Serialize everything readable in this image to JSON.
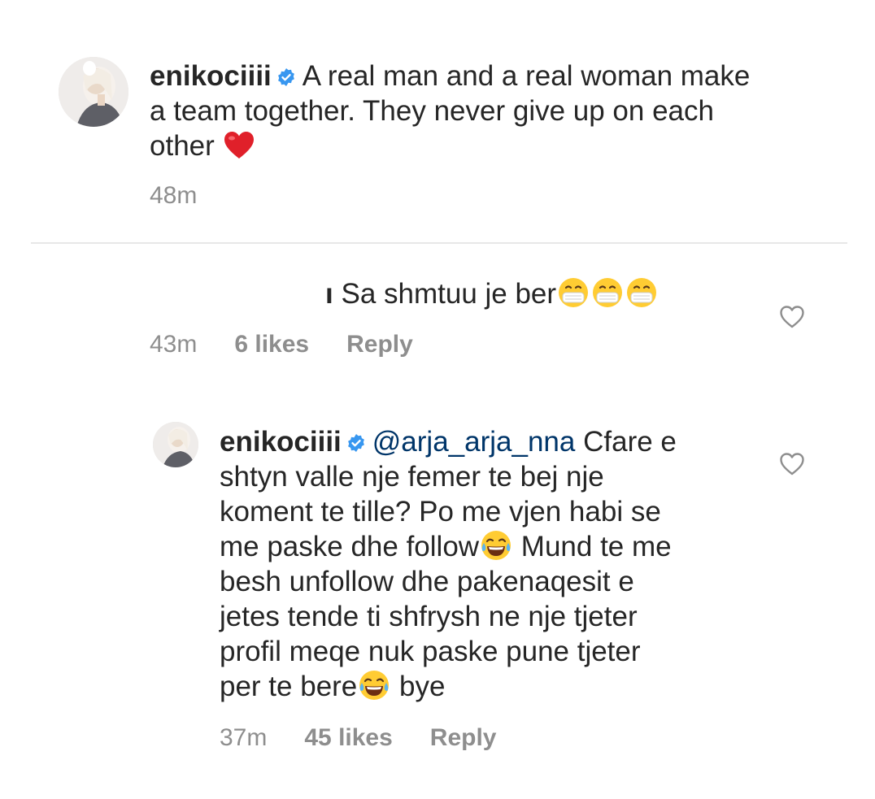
{
  "caption": {
    "username": "enikociiii",
    "text_line1": "A real man and a real woman make",
    "text_line2": "a team together. They never give up on each",
    "text_line3": "other",
    "time": "48m"
  },
  "comment": {
    "username_fragment": "ı",
    "text": "Sa shmtuu je ber",
    "time": "43m",
    "likes": "6 likes",
    "reply_label": "Reply"
  },
  "reply": {
    "username": "enikociiii",
    "mention": "@arja_arja_nna",
    "line1": "Cfare e",
    "line2": "shtyn valle nje femer te bej nje",
    "line3": "koment te tille? Po me vjen habi se",
    "line4a": "me paske dhe follow",
    "line4b": " Mund te me",
    "line5": "besh unfollow dhe pakenaqesit e",
    "line6": "jetes tende ti shfrysh ne nje tjeter",
    "line7": "profil meqe nuk paske pune tjeter",
    "line8a": "per te bere",
    "line8b": " bye",
    "time": "37m",
    "likes": "45 likes",
    "reply_label": "Reply"
  },
  "icons": {
    "verified": "verified-badge-icon",
    "heart": "heart-outline-icon",
    "emoji_mask": "face-with-medical-mask-emoji",
    "emoji_tears": "face-with-tears-of-joy-emoji",
    "emoji_heart": "red-heart-emoji"
  },
  "colors": {
    "text": "#262626",
    "meta": "#8e8e8e",
    "verified": "#3897f0",
    "mention": "#003569",
    "heart_emoji": "#e0202a"
  }
}
